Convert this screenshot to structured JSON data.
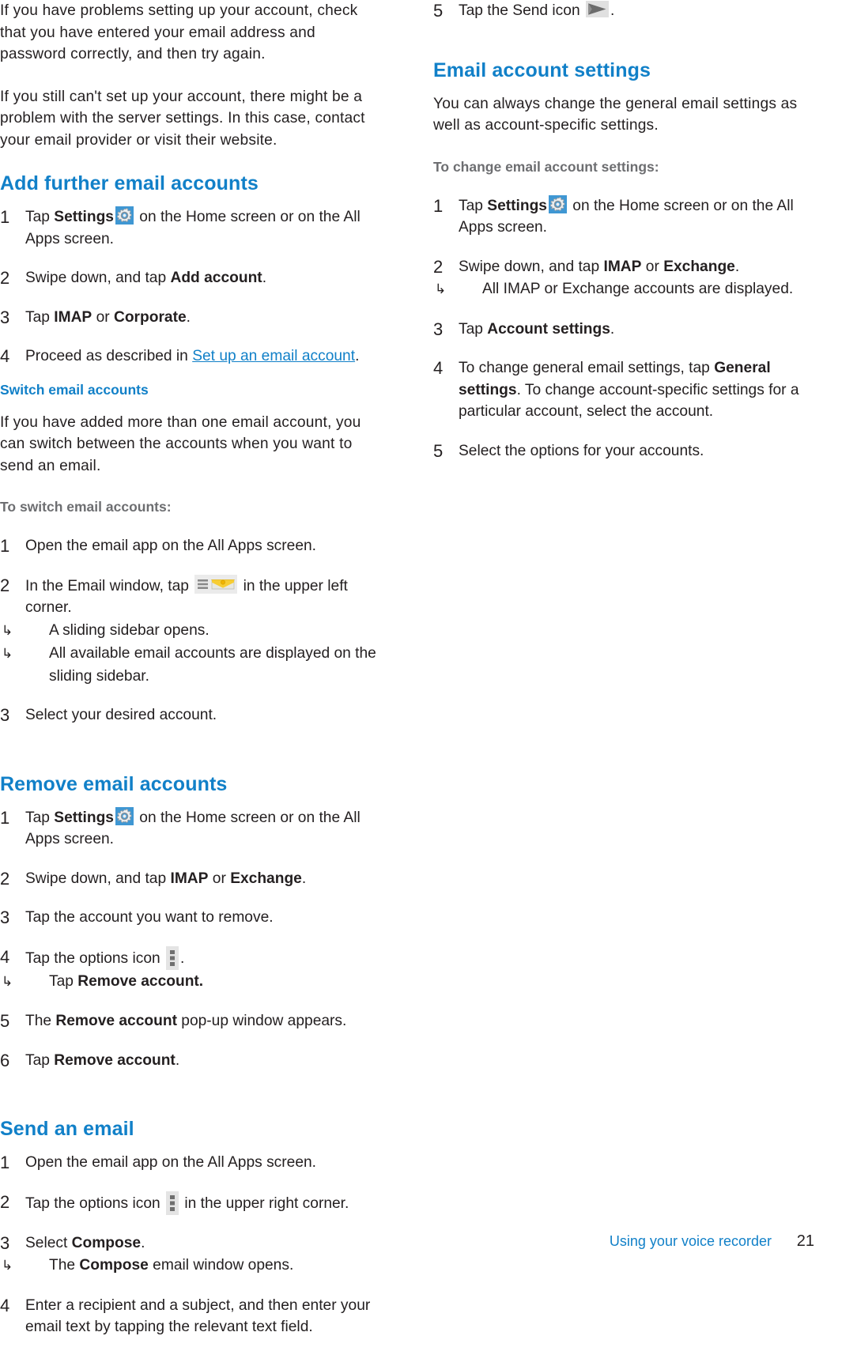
{
  "colors": {
    "heading_blue": "#1180c8",
    "body_black": "#231f20",
    "lead_grey": "#6d6e71",
    "link_blue": "#1180c8",
    "settings_tile": "#3f97d3",
    "icon_tile_grey": "#e4e4e4",
    "envelope_gold": "#f5c518"
  },
  "icons": {
    "settings": "settings-gear-icon",
    "email_sidebar": "email-sidebar-icon",
    "options": "options-three-dots-icon",
    "send": "send-paper-plane-icon",
    "arrow_bullet": "↳"
  },
  "left_column": {
    "intro_paragraph_1": "If you have problems setting up your account, check that you have entered your email address and password correctly, and then try again.",
    "intro_paragraph_2": "If you still can't set up your account, there might be a problem with the server settings. In this case, contact your email provider or visit their website.",
    "add_accounts": {
      "heading": "Add further email accounts",
      "steps": [
        {
          "num": "1",
          "pre": "Tap ",
          "bold": "Settings",
          "icon": "settings",
          "post": " on the Home screen or on the All Apps screen."
        },
        {
          "num": "2",
          "pre": "Swipe down, and tap ",
          "bold": "Add account",
          "post": "."
        },
        {
          "num": "3",
          "pre": "Tap ",
          "bold": "IMAP",
          "mid": " or ",
          "bold2": "Corporate",
          "post": "."
        },
        {
          "num": "4",
          "pre": "Proceed as described in ",
          "link": "Set up an email account",
          "post": "."
        }
      ]
    },
    "switch_accounts": {
      "subheading": "Switch email accounts",
      "paragraph": "If you have added more than one email account, you can switch between the accounts when you want to send an email.",
      "lead": "To switch email accounts:",
      "steps": [
        {
          "num": "1",
          "text": "Open the email app on the All Apps screen."
        },
        {
          "num": "2",
          "pre": "In the Email window, tap ",
          "icon": "email_sidebar",
          "post": " in the upper left corner.",
          "sub": [
            "A sliding sidebar opens.",
            "All available email accounts are displayed on the sliding sidebar."
          ]
        },
        {
          "num": "3",
          "text": "Select your desired account."
        }
      ]
    },
    "remove_accounts": {
      "heading": "Remove email accounts",
      "steps": [
        {
          "num": "1",
          "pre": "Tap ",
          "bold": "Settings",
          "icon": "settings",
          "post": " on the Home screen or on the All Apps screen."
        },
        {
          "num": "2",
          "pre": "Swipe down, and tap ",
          "bold": "IMAP",
          "mid": " or ",
          "bold2": "Exchange",
          "post": "."
        },
        {
          "num": "3",
          "text": "Tap the account you want to remove."
        },
        {
          "num": "4",
          "pre": "Tap the options icon ",
          "icon": "options",
          "post": ".",
          "sub_pre": "Tap ",
          "sub_bold": "Remove account."
        },
        {
          "num": "5",
          "pre": "The ",
          "bold": "Remove account",
          "post": " pop-up window appears."
        },
        {
          "num": "6",
          "pre": "Tap ",
          "bold": "Remove account",
          "post": "."
        }
      ]
    },
    "send_email": {
      "heading": "Send an email",
      "steps": [
        {
          "num": "1",
          "text": "Open the email app on the All Apps screen."
        },
        {
          "num": "2",
          "pre": "Tap the options icon ",
          "icon": "options",
          "post": " in the upper right corner."
        },
        {
          "num": "3",
          "pre": "Select ",
          "bold": "Compose",
          "post": ".",
          "sub_pre": "The ",
          "sub_bold": "Compose",
          "sub_post": " email window opens."
        },
        {
          "num": "4",
          "text": "Enter a recipient and a subject, and then enter your email text by tapping the relevant text field."
        }
      ]
    }
  },
  "right_column": {
    "continued_step": {
      "num": "5",
      "pre": "Tap the Send icon ",
      "icon": "send",
      "post": "."
    },
    "email_settings": {
      "heading": "Email account settings",
      "paragraph": "You can always change the general email settings as well as account-specific settings.",
      "lead": "To change email account settings:",
      "steps": [
        {
          "num": "1",
          "pre": "Tap ",
          "bold": "Settings",
          "icon": "settings",
          "post": " on the Home screen or on the All Apps screen."
        },
        {
          "num": "2",
          "pre": "Swipe down, and tap ",
          "bold": "IMAP",
          "mid": " or ",
          "bold2": "Exchange",
          "post": ".",
          "sub": [
            "All IMAP or Exchange accounts are displayed."
          ]
        },
        {
          "num": "3",
          "pre": "Tap ",
          "bold": "Account settings",
          "post": "."
        },
        {
          "num": "4",
          "pre": "To change general email settings, tap ",
          "bold": "General settings",
          "post": ". To change account-specific settings for a particular account, select the account."
        },
        {
          "num": "5",
          "text": "Select the options for your accounts."
        }
      ]
    }
  },
  "footer": {
    "title": "Using your voice recorder",
    "page_number": "21"
  }
}
